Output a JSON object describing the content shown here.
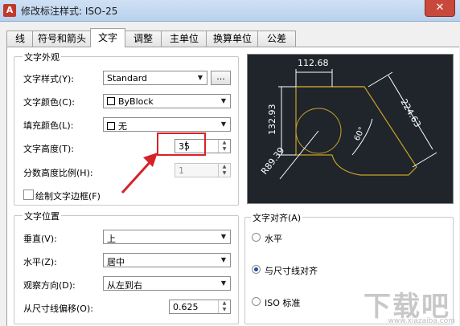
{
  "window": {
    "title": "修改标注样式: ISO-25",
    "close_label": "✕"
  },
  "tabs": [
    {
      "label": "线"
    },
    {
      "label": "符号和箭头"
    },
    {
      "label": "文字"
    },
    {
      "label": "调整"
    },
    {
      "label": "主单位"
    },
    {
      "label": "换算单位"
    },
    {
      "label": "公差"
    }
  ],
  "active_tab": "文字",
  "text_appearance": {
    "group_title": "文字外观",
    "style_label": "文字样式(Y):",
    "style_value": "Standard",
    "browse_label": "...",
    "color_label": "文字颜色(C):",
    "color_value": "ByBlock",
    "fill_label": "填充颜色(L):",
    "fill_value": "无",
    "height_label": "文字高度(T):",
    "height_value": "35",
    "fraction_label": "分数高度比例(H):",
    "fraction_value": "1",
    "frame_label": "绘制文字边框(F)"
  },
  "text_placement": {
    "group_title": "文字位置",
    "vertical_label": "垂直(V):",
    "vertical_value": "上",
    "horizontal_label": "水平(Z):",
    "horizontal_value": "居中",
    "view_dir_label": "观察方向(D):",
    "view_dir_value": "从左到右",
    "offset_label": "从尺寸线偏移(O):",
    "offset_value": "0.625"
  },
  "text_alignment": {
    "group_title": "文字对齐(A)",
    "options": [
      {
        "label": "水平",
        "selected": false
      },
      {
        "label": "与尺寸线对齐",
        "selected": true
      },
      {
        "label": "ISO 标准",
        "selected": false
      }
    ]
  },
  "preview": {
    "dim_top": "112.68",
    "dim_left": "132.93",
    "dim_right": "224.63",
    "dim_radius": "R89.39",
    "dim_angle": "60°",
    "colors": {
      "background": "#1f252b",
      "outline": "#c9a227",
      "lines": "#ffffff"
    }
  },
  "watermark": {
    "text": "下载吧",
    "url": "www.xiazaiba.com"
  },
  "colors": {
    "highlight": "#d6232a"
  }
}
